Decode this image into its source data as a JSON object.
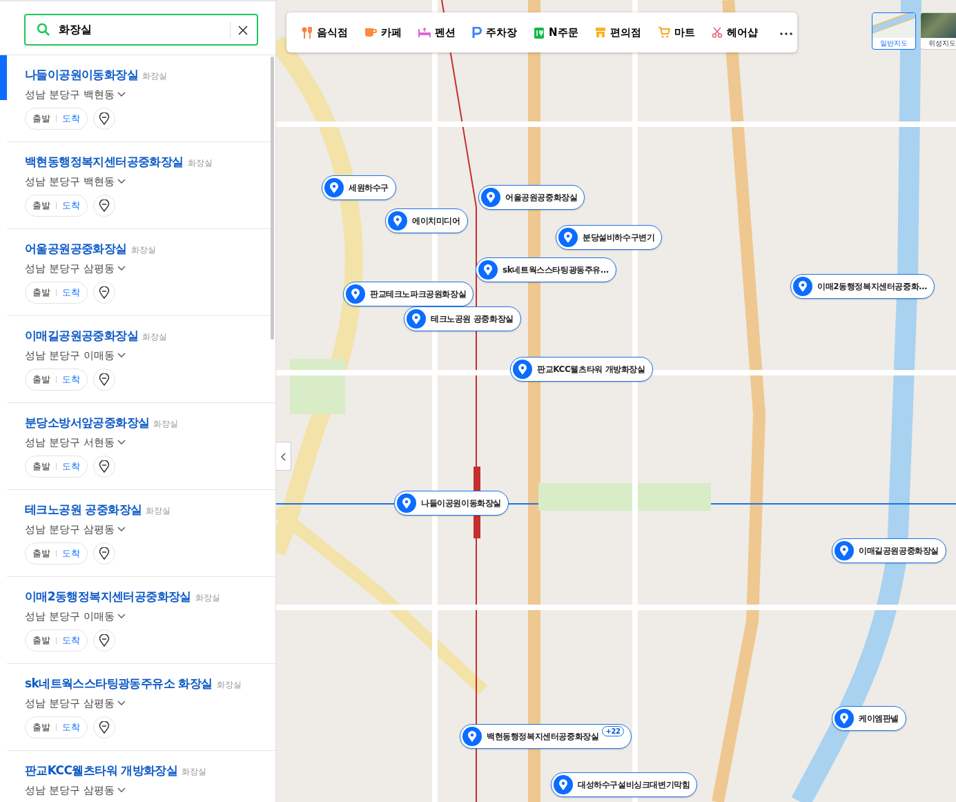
{
  "search": {
    "value": "화장실"
  },
  "results": [
    {
      "name": "나들이공원이동화장실",
      "category": "화장실",
      "address": "성남 분당구 백현동",
      "depart": "출발",
      "arrive": "도착",
      "selected": true
    },
    {
      "name": "백현동행정복지센터공중화장실",
      "category": "화장실",
      "address": "성남 분당구 백현동",
      "depart": "출발",
      "arrive": "도착",
      "selected": false
    },
    {
      "name": "어울공원공중화장실",
      "category": "화장실",
      "address": "성남 분당구 삼평동",
      "depart": "출발",
      "arrive": "도착",
      "selected": false
    },
    {
      "name": "이매길공원공중화장실",
      "category": "화장실",
      "address": "성남 분당구 이매동",
      "depart": "출발",
      "arrive": "도착",
      "selected": false
    },
    {
      "name": "분당소방서앞공중화장실",
      "category": "화장실",
      "address": "성남 분당구 서현동",
      "depart": "출발",
      "arrive": "도착",
      "selected": false
    },
    {
      "name": "테크노공원 공중화장실",
      "category": "화장실",
      "address": "성남 분당구 삼평동",
      "depart": "출발",
      "arrive": "도착",
      "selected": false
    },
    {
      "name": "이매2동행정복지센터공중화장실",
      "category": "화장실",
      "address": "성남 분당구 이매동",
      "depart": "출발",
      "arrive": "도착",
      "selected": false
    },
    {
      "name": "sk네트웍스스타팅광동주유소 화장실",
      "category": "화장실",
      "address": "성남 분당구 삼평동",
      "depart": "출발",
      "arrive": "도착",
      "selected": false
    },
    {
      "name": "판교KCC웰츠타워 개방화장실",
      "category": "화장실",
      "address": "성남 분당구 삼평동",
      "selected": false
    }
  ],
  "categories": [
    {
      "label": "음식점",
      "kind": "food"
    },
    {
      "label": "카페",
      "kind": "cafe"
    },
    {
      "label": "펜션",
      "kind": "bed"
    },
    {
      "label": "주차장",
      "kind": "parking"
    },
    {
      "label": "N주문",
      "kind": "order"
    },
    {
      "label": "편의점",
      "kind": "store"
    },
    {
      "label": "마트",
      "kind": "cart"
    },
    {
      "label": "헤어샵",
      "kind": "scissors"
    }
  ],
  "map_types": [
    {
      "label": "일반지도",
      "kind": "normal",
      "selected": true
    },
    {
      "label": "위성지도",
      "kind": "satellite",
      "selected": false
    }
  ],
  "pins": [
    {
      "label": "세원하수구"
    },
    {
      "label": "어울공원공중화장실"
    },
    {
      "label": "에이치미디어"
    },
    {
      "label": "분당설비하수구변기"
    },
    {
      "label": "sk네트웍스스타팅광동주유…"
    },
    {
      "label": "이매2동행정복지센터공중화…"
    },
    {
      "label": "판교테크노파크공원화장실"
    },
    {
      "label": "테크노공원 공중화장실"
    },
    {
      "label": "판교KCC웰츠타워 개방화장실"
    },
    {
      "label": "나들이공원이동화장실"
    },
    {
      "label": "이매길공원공중화장실"
    },
    {
      "label": "케이엠판넬"
    },
    {
      "label": "백현동행정복지센터공중화장실",
      "count": "+22"
    },
    {
      "label": "대성하수구설비싱크대변기막힘"
    }
  ]
}
